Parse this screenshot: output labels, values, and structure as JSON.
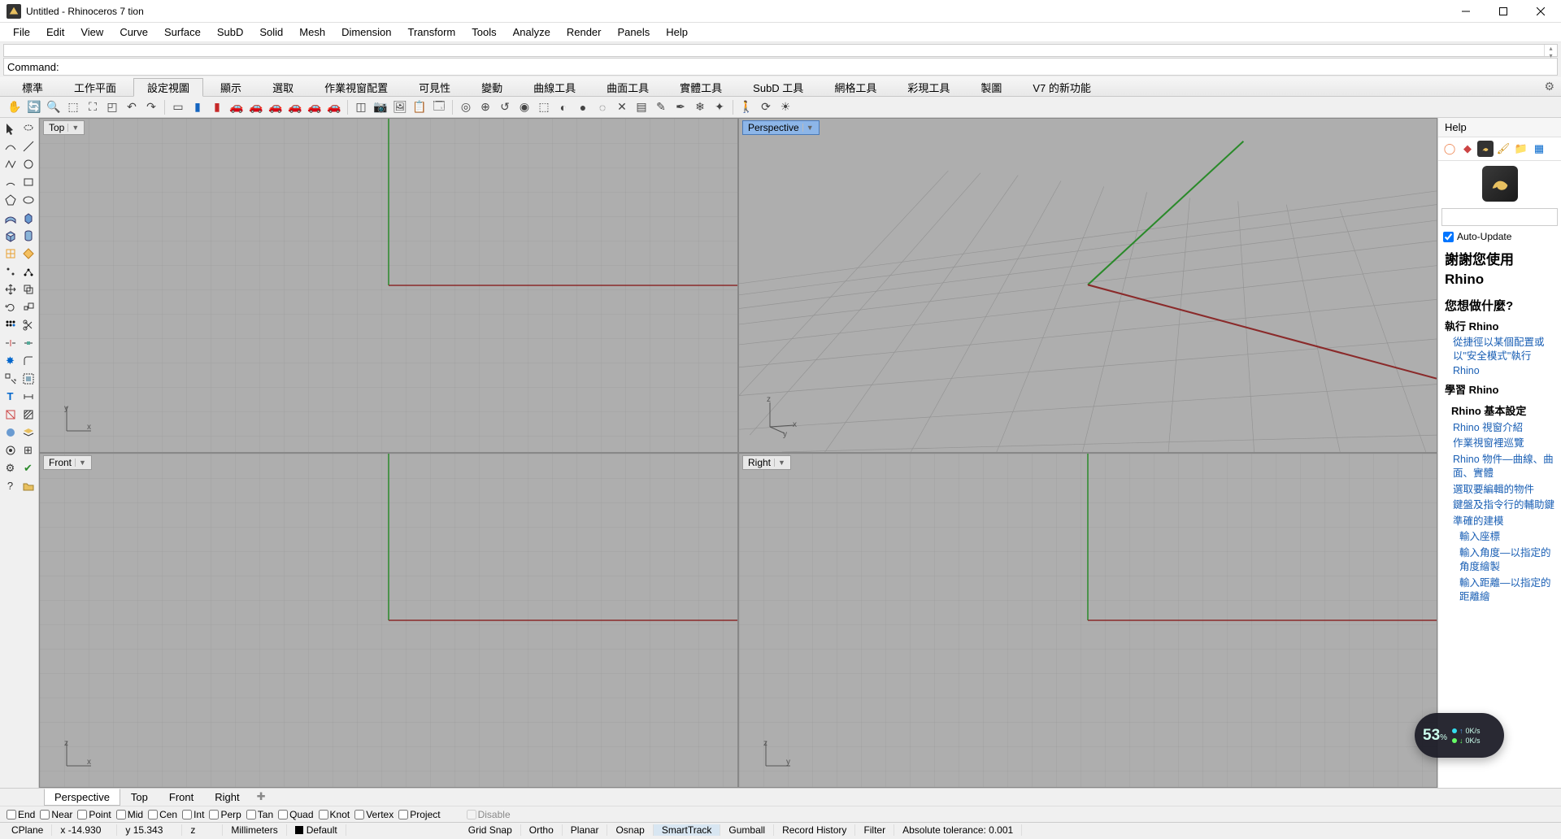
{
  "title": "Untitled - Rhinoceros 7 tion",
  "menu": [
    "File",
    "Edit",
    "View",
    "Curve",
    "Surface",
    "SubD",
    "Solid",
    "Mesh",
    "Dimension",
    "Transform",
    "Tools",
    "Analyze",
    "Render",
    "Panels",
    "Help"
  ],
  "command_label": "Command:",
  "command_value": "",
  "tabs": [
    "標準",
    "工作平面",
    "設定視圖",
    "顯示",
    "選取",
    "作業視窗配置",
    "可見性",
    "變動",
    "曲線工具",
    "曲面工具",
    "實體工具",
    "SubD 工具",
    "網格工具",
    "彩現工具",
    "製圖",
    "V7 的新功能"
  ],
  "active_tab": 2,
  "viewports": {
    "top": {
      "label": "Top",
      "ax1": "x",
      "ax2": "y"
    },
    "persp": {
      "label": "Perspective",
      "ax1": "x",
      "ax2": "y",
      "ax3": "z"
    },
    "front": {
      "label": "Front",
      "ax1": "x",
      "ax2": "z"
    },
    "right": {
      "label": "Right",
      "ax1": "y",
      "ax2": "z"
    }
  },
  "active_viewport": "persp",
  "help_panel": {
    "title": "Help",
    "auto_update": "Auto-Update",
    "thanks": "謝謝您使用 Rhino",
    "what": "您想做什麼?",
    "run_head": "執行 Rhino",
    "run_link": "從捷徑以某個配置或以\"安全模式\"執行 Rhino",
    "learn_head": "學習 Rhino",
    "basics_head": "Rhino 基本設定",
    "links": [
      "Rhino 視窗介紹",
      "作業視窗裡巡覽",
      "Rhino 物件—曲線、曲面、實體",
      "選取要編輯的物件",
      "鍵盤及指令行的輔助鍵",
      "準確的建模",
      "輸入座標",
      "輸入角度—以指定的角度繪製",
      "輸入距離—以指定的距離繪"
    ]
  },
  "vptabs": [
    "Perspective",
    "Top",
    "Front",
    "Right"
  ],
  "active_vptab": 0,
  "osnap": {
    "items": [
      "End",
      "Near",
      "Point",
      "Mid",
      "Cen",
      "Int",
      "Perp",
      "Tan",
      "Quad",
      "Knot",
      "Vertex",
      "Project"
    ],
    "disable": "Disable"
  },
  "status": {
    "cplane": "CPlane",
    "x": "x -14.930",
    "y": "y 15.343",
    "z": "z",
    "units": "Millimeters",
    "layer": "Default",
    "toggles": [
      "Grid Snap",
      "Ortho",
      "Planar",
      "Osnap",
      "SmartTrack",
      "Gumball",
      "Record History",
      "Filter"
    ],
    "active_toggle": "SmartTrack",
    "tol": "Absolute tolerance: 0.001"
  },
  "perf": {
    "pct": "53",
    "pct_sym": "%",
    "up": "0K/s",
    "dn": "0K/s"
  }
}
